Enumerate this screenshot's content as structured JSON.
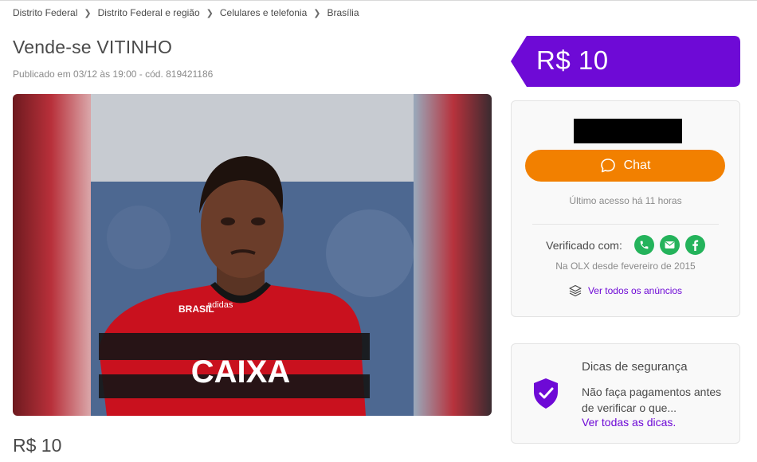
{
  "breadcrumb": [
    "Distrito Federal",
    "Distrito Federal e região",
    "Celulares e telefonia",
    "Brasília"
  ],
  "ad": {
    "title": "Vende-se VITINHO",
    "meta": "Publicado em 03/12 às 19:00 - cód. 819421186",
    "price": "R$ 10"
  },
  "seller": {
    "chat_label": "Chat",
    "last_access": "Último acesso há 11 horas",
    "verified_label": "Verificado com:",
    "verified_methods": [
      "phone-icon",
      "email-icon",
      "facebook-icon"
    ],
    "since": "Na OLX desde fevereiro de 2015",
    "all_ads_label": "Ver todos os anúncios"
  },
  "tips": {
    "title": "Dicas de segurança",
    "text": "Não faça pagamentos antes de verificar o que...",
    "link": "Ver todas as dicas."
  },
  "colors": {
    "brand_purple": "#6e0ad6",
    "chat_orange": "#f28000",
    "verified_green": "#24b35b",
    "text": "#4a4a4a"
  }
}
